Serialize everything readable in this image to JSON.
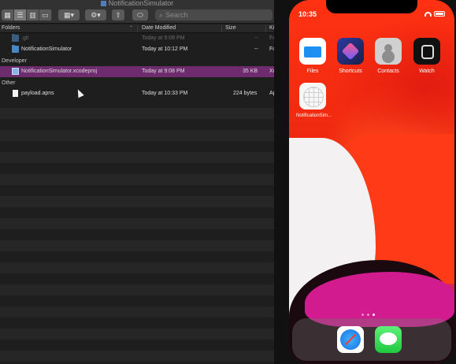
{
  "finder": {
    "window_title": "NotificationSimulator",
    "search_placeholder": "Search",
    "columns": {
      "name": "Folders",
      "date": "Date Modified",
      "size": "Size",
      "kind": "Ki"
    },
    "rows": [
      {
        "name": ".git",
        "date": "Today at 9:08 PM",
        "size": "--",
        "kind": "Fo",
        "dim": true
      },
      {
        "name": "NotificationSimulator",
        "date": "Today at 10:12 PM",
        "size": "--",
        "kind": "Fo"
      }
    ],
    "groups": [
      {
        "label": "Developer",
        "rows": [
          {
            "name": "NotificationSimulator.xcodeproj",
            "date": "Today at 9:08 PM",
            "size": "35 KB",
            "kind": "Xc"
          }
        ]
      },
      {
        "label": "Other",
        "rows": [
          {
            "name": "payload.apns",
            "date": "Today at 10:33 PM",
            "size": "224 bytes",
            "kind": "Ap"
          }
        ]
      }
    ]
  },
  "simulator": {
    "time": "10:35",
    "apps": [
      "Files",
      "Shortcuts",
      "Contacts",
      "Watch",
      "NotificationSim..."
    ],
    "dock": [
      "safari-icon",
      "messages-icon"
    ]
  },
  "colors": {
    "selection": "#6e2b6e",
    "folder": "#4b86c4",
    "wallpaper_red": "#ff3112"
  }
}
